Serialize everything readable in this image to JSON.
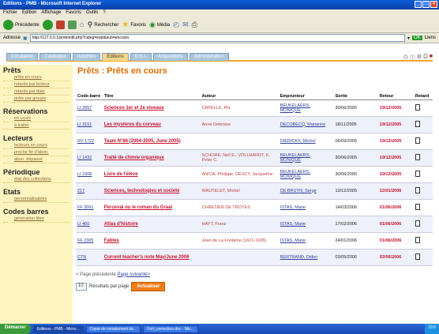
{
  "window": {
    "title": "Editions - PMB - Microsoft Internet Explorer"
  },
  "menu": [
    "Fichier",
    "Edition",
    "Affichage",
    "Favoris",
    "Outils",
    "?"
  ],
  "toolbar": {
    "back": "Précédente",
    "search": "Rechercher",
    "favorites": "Favoris",
    "media": "Média"
  },
  "address": {
    "label": "Adresse",
    "url": "http://127.0.0.1/pmb/edit.php?categ=expl&sub=encours",
    "go": "OK",
    "links": "Liens"
  },
  "tabs": [
    "Circulation",
    "Catalogue",
    "Autorités",
    "Editions",
    "D.S.I.",
    "Acquisitions",
    "Administration"
  ],
  "sidebar": [
    {
      "heading": "Prêts",
      "items": [
        "prêts en cours",
        "retards par lecteur",
        "retards par date",
        "prêts par groupe"
      ]
    },
    {
      "heading": "Réservations",
      "items": [
        "en cours",
        "à traiter"
      ]
    },
    {
      "heading": "Lecteurs",
      "items": [
        "lecteurs en cours",
        "proche fin d'abon.",
        "abon. dépassé"
      ]
    },
    {
      "heading": "Périodique",
      "items": [
        "état des collections"
      ]
    },
    {
      "heading": "Etats",
      "items": [
        "personnalisables"
      ]
    },
    {
      "heading": "Codes barres",
      "items": [
        "génération libre"
      ]
    }
  ],
  "main": {
    "title": "Prêts : Prêts en cours",
    "columns": [
      "Code-barre",
      "Titre",
      "Auteur",
      "Emprunteur",
      "Sortie",
      "Retour",
      "Retard"
    ],
    "rows": [
      {
        "code": "LI 2857",
        "titre": "Sciences 1er et 2e niveaux",
        "auteur": "CAPELLE, PH.",
        "emp": "BEUKELAERS, MONIQUE",
        "sortie": "30/06/2005",
        "retour": "19/12/2005"
      },
      {
        "code": "LI 3151",
        "titre": "Les mystères du corveau",
        "auteur": "Anne Debroise",
        "emp": "DECOBECQ, Marianne",
        "sortie": "18/11/2005",
        "retour": "19/12/2005"
      },
      {
        "code": "RV 1722",
        "titre": "Team N°86 (2004-2005, June 2005)",
        "auteur": "",
        "emp": "DIERICKX, Michel",
        "sortie": "06/09/2005",
        "retour": "19/12/2005"
      },
      {
        "code": "LI 1432",
        "titre": "Traité de chimie organique",
        "auteur": "SCHORE, Neil E., VOLLHARDT, K. Peter C.",
        "emp": "BEUKELAERS, MONIQUE",
        "sortie": "30/06/2005",
        "retour": "19/12/2005"
      },
      {
        "code": "LI 2308",
        "titre": "Livre de l'élève",
        "auteur": "ANCIA, Philippe, DESCY, Jacqueline",
        "emp": "BEUKELAERS, MONIQUE",
        "sortie": "30/06/2005",
        "retour": "19/12/2005"
      },
      {
        "code": "217",
        "titre": "Sciences, technologies et société",
        "auteur": "WAUTELET, Michel",
        "emp": "DE BRUYN, Serge",
        "sortie": "13/12/2005",
        "retour": "12/01/2006"
      },
      {
        "code": "FF 3061",
        "titre": "Perceval ou le roman du Graal",
        "auteur": "CHRETIEN DE TROYES",
        "emp": "ISTAS, Marie",
        "sortie": "14/03/2006",
        "retour": "01/06/2006"
      },
      {
        "code": "LI 460",
        "titre": "Atlas d'histoire",
        "auteur": "HAYT, Franz",
        "emp": "ISTAS, Marie",
        "sortie": "17/02/2006",
        "retour": "01/06/2006"
      },
      {
        "code": "FF 2305",
        "titre": "Fables",
        "auteur": "Jean de La Fontaine (1621-1695)",
        "emp": "ISTAS, Marie",
        "sortie": "24/01/2006",
        "retour": "01/06/2006"
      },
      {
        "code": "CTN",
        "titre": "Current teacher's note May/June 2006",
        "auteur": "",
        "emp": "BERTRAND, Didier",
        "sortie": "03/05/2006",
        "retour": "02/06/2006"
      }
    ],
    "pager": {
      "prev": "< Page précédente",
      "next": "Page suivante>"
    },
    "perpage": {
      "value": "10",
      "label": "Résultats par page",
      "button": "Actualiser"
    }
  },
  "taskbar": {
    "start": "Démarrer",
    "tasks": [
      "Editions - PMB - Micro...",
      "Copie de complement.do...",
      "Fort_correction.doc - Mic..."
    ],
    "clock": "19:5"
  }
}
